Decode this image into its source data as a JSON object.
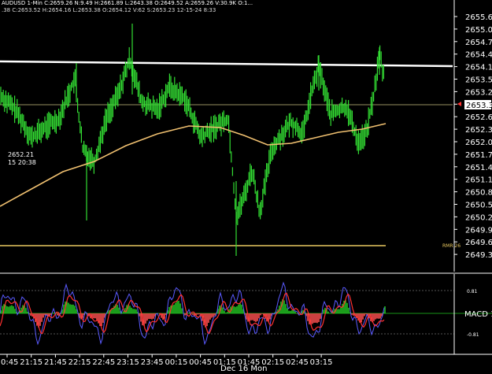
{
  "header": {
    "line1": "AUDUSD  1-Min  C:2659.26  N:9.49  H:2661.89  L:2643.38  O:2649.52  A:2659.26  V:30.9K  O:1...",
    "line2": ".38  C:2653.52  H:2654.16  L:2653.38  O:2654.12  V:62  S:2653.23  12-15-24  8:33"
  },
  "price_axis": {
    "ticks": [
      "2655.60",
      "2655.00",
      "2654.70",
      "2654.40",
      "2654.10",
      "2653.50",
      "2653.20",
      "2652.90",
      "2652.60",
      "2652.30",
      "2652.00",
      "2651.70",
      "2651.40",
      "2651.10",
      "2650.80",
      "2650.50",
      "2650.20",
      "2649.90",
      "2649.60",
      "2649.30"
    ],
    "current_price": "2653.35"
  },
  "crosshair_label": {
    "price": "2652.21",
    "time": "15 20:38"
  },
  "level_label": "RMR 26",
  "macd_panel": {
    "label": "MACD 1",
    "upper_level": "0.81",
    "lower_level": "-0.81"
  },
  "time_axis": {
    "ticks": [
      "20:45",
      "21:15",
      "21:45",
      "22:15",
      "22:45",
      "23:15",
      "23:45",
      "00:15",
      "00:45",
      "01:15",
      "01:45",
      "02:15",
      "02:45",
      "03:15"
    ],
    "date_label": "Dec 16 Mon"
  },
  "colors": {
    "candles": "#33dd33",
    "moving_average": "#f0c070",
    "resistance_line": "#ffffff",
    "support_line": "#e8c860",
    "mid_line": "#c8c080",
    "macd_fast": "#5a5aff",
    "macd_slow": "#ff3030",
    "macd_hist_pos": "#22c422",
    "macd_hist_neg": "#ff5050",
    "current_price_marker": "#ff3030"
  }
}
